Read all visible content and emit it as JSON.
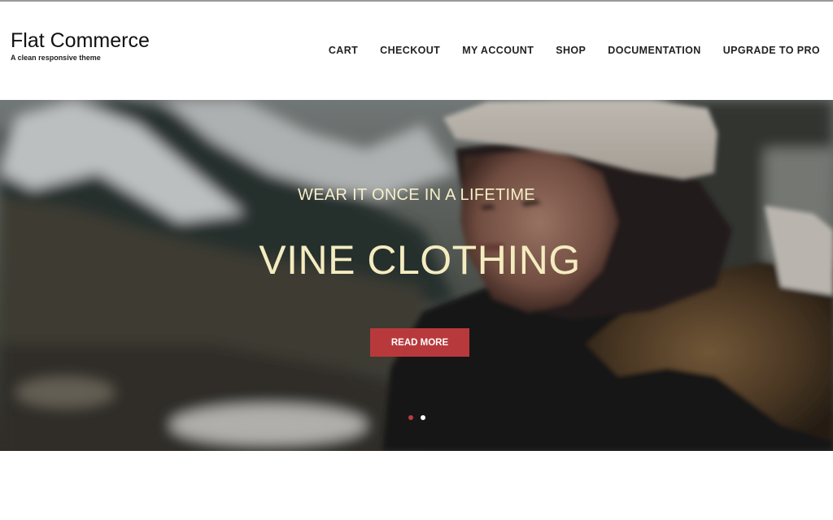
{
  "header": {
    "site_title": "Flat Commerce",
    "tagline": "A clean responsive theme"
  },
  "nav": {
    "items": [
      {
        "label": "CART"
      },
      {
        "label": "CHECKOUT"
      },
      {
        "label": "MY ACCOUNT"
      },
      {
        "label": "SHOP"
      },
      {
        "label": "DOCUMENTATION"
      },
      {
        "label": "UPGRADE TO PRO"
      }
    ]
  },
  "hero": {
    "subtitle": "WEAR IT ONCE IN A LIFETIME",
    "title": "VINE CLOTHING",
    "button_label": "READ MORE",
    "slide_count": 2,
    "active_slide": 1
  },
  "colors": {
    "accent": "#b8393c",
    "hero_text": "#f4ecc0"
  }
}
